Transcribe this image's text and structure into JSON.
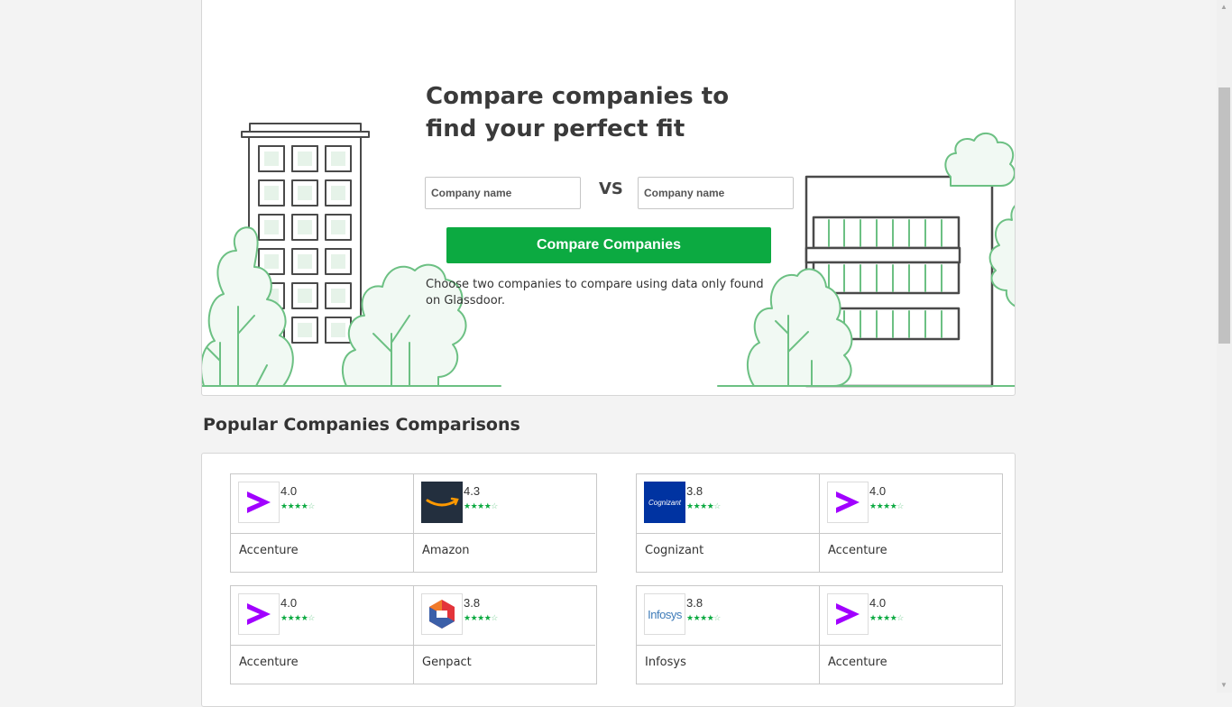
{
  "hero": {
    "title": "Compare companies to find your perfect fit",
    "left_input_placeholder": "Company name",
    "right_input_placeholder": "Company name",
    "vs_label": "VS",
    "compare_button": "Compare Companies",
    "hint": "Choose two companies to compare using data only found on Glassdoor."
  },
  "section": {
    "title": "Popular Companies Comparisons"
  },
  "colors": {
    "accent": "#0caa41",
    "accenture_purple": "#a100ff",
    "amazon_bg": "#232f3e",
    "cognizant_bg": "#0033a1"
  },
  "comparisons": [
    [
      {
        "name": "Accenture",
        "rating": "4.0",
        "stars": 4,
        "logo": "accenture-logo"
      },
      {
        "name": "Amazon",
        "rating": "4.3",
        "stars": 4,
        "logo": "amazon-logo"
      }
    ],
    [
      {
        "name": "Cognizant",
        "rating": "3.8",
        "stars": 4,
        "logo": "cognizant-logo",
        "logo_text": "Cognizant"
      },
      {
        "name": "Accenture",
        "rating": "4.0",
        "stars": 4,
        "logo": "accenture-logo"
      }
    ],
    [
      {
        "name": "Accenture",
        "rating": "4.0",
        "stars": 4,
        "logo": "accenture-logo"
      },
      {
        "name": "Genpact",
        "rating": "3.8",
        "stars": 4,
        "logo": "genpact-logo"
      }
    ],
    [
      {
        "name": "Infosys",
        "rating": "3.8",
        "stars": 4,
        "logo": "infosys-logo",
        "logo_text": "Infosys"
      },
      {
        "name": "Accenture",
        "rating": "4.0",
        "stars": 4,
        "logo": "accenture-logo"
      }
    ]
  ]
}
